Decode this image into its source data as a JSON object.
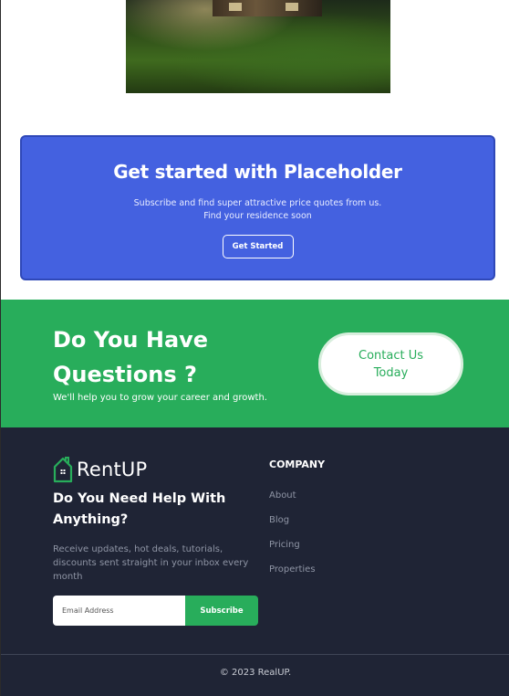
{
  "hero": {
    "image_alt": "house-photo"
  },
  "cta": {
    "title": "Get started with Placeholder",
    "subtitle_line1": "Subscribe and find super attractive price quotes from us.",
    "subtitle_line2": "Find your residence soon",
    "button_label": "Get Started",
    "bg_color": "#4461e0"
  },
  "questions": {
    "title": "Do You Have Questions ?",
    "subtitle": "We'll help you to grow your career and growth.",
    "button_label": "Contact Us Today",
    "bg_color": "#28ad5b"
  },
  "footer": {
    "logo_text": "RentUP",
    "logo_icon": "house-icon",
    "help_title": "Do You Need Help With Anything?",
    "help_text": "Receive updates, hot deals, tutorials, discounts sent straight in your inbox every month",
    "email_placeholder": "Email Address",
    "subscribe_label": "Subscribe",
    "company_title": "COMPANY",
    "company_links": [
      "About",
      "Blog",
      "Pricing",
      "Properties"
    ],
    "copyright": "© 2023 RealUP.",
    "bg_color": "#1f2435"
  }
}
